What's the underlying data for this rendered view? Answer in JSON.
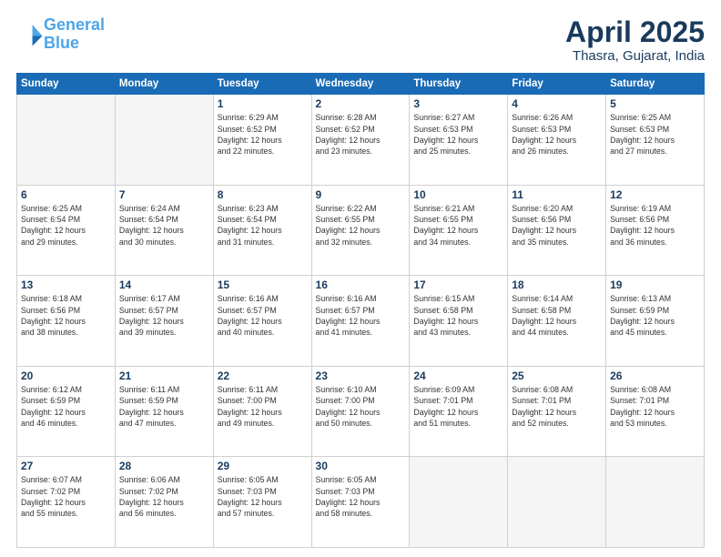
{
  "header": {
    "logo_line1": "General",
    "logo_line2": "Blue",
    "month_title": "April 2025",
    "location": "Thasra, Gujarat, India"
  },
  "weekdays": [
    "Sunday",
    "Monday",
    "Tuesday",
    "Wednesday",
    "Thursday",
    "Friday",
    "Saturday"
  ],
  "weeks": [
    [
      {
        "day": "",
        "empty": true
      },
      {
        "day": "",
        "empty": true
      },
      {
        "day": "1",
        "lines": [
          "Sunrise: 6:29 AM",
          "Sunset: 6:52 PM",
          "Daylight: 12 hours",
          "and 22 minutes."
        ]
      },
      {
        "day": "2",
        "lines": [
          "Sunrise: 6:28 AM",
          "Sunset: 6:52 PM",
          "Daylight: 12 hours",
          "and 23 minutes."
        ]
      },
      {
        "day": "3",
        "lines": [
          "Sunrise: 6:27 AM",
          "Sunset: 6:53 PM",
          "Daylight: 12 hours",
          "and 25 minutes."
        ]
      },
      {
        "day": "4",
        "lines": [
          "Sunrise: 6:26 AM",
          "Sunset: 6:53 PM",
          "Daylight: 12 hours",
          "and 26 minutes."
        ]
      },
      {
        "day": "5",
        "lines": [
          "Sunrise: 6:25 AM",
          "Sunset: 6:53 PM",
          "Daylight: 12 hours",
          "and 27 minutes."
        ]
      }
    ],
    [
      {
        "day": "6",
        "lines": [
          "Sunrise: 6:25 AM",
          "Sunset: 6:54 PM",
          "Daylight: 12 hours",
          "and 29 minutes."
        ]
      },
      {
        "day": "7",
        "lines": [
          "Sunrise: 6:24 AM",
          "Sunset: 6:54 PM",
          "Daylight: 12 hours",
          "and 30 minutes."
        ]
      },
      {
        "day": "8",
        "lines": [
          "Sunrise: 6:23 AM",
          "Sunset: 6:54 PM",
          "Daylight: 12 hours",
          "and 31 minutes."
        ]
      },
      {
        "day": "9",
        "lines": [
          "Sunrise: 6:22 AM",
          "Sunset: 6:55 PM",
          "Daylight: 12 hours",
          "and 32 minutes."
        ]
      },
      {
        "day": "10",
        "lines": [
          "Sunrise: 6:21 AM",
          "Sunset: 6:55 PM",
          "Daylight: 12 hours",
          "and 34 minutes."
        ]
      },
      {
        "day": "11",
        "lines": [
          "Sunrise: 6:20 AM",
          "Sunset: 6:56 PM",
          "Daylight: 12 hours",
          "and 35 minutes."
        ]
      },
      {
        "day": "12",
        "lines": [
          "Sunrise: 6:19 AM",
          "Sunset: 6:56 PM",
          "Daylight: 12 hours",
          "and 36 minutes."
        ]
      }
    ],
    [
      {
        "day": "13",
        "lines": [
          "Sunrise: 6:18 AM",
          "Sunset: 6:56 PM",
          "Daylight: 12 hours",
          "and 38 minutes."
        ]
      },
      {
        "day": "14",
        "lines": [
          "Sunrise: 6:17 AM",
          "Sunset: 6:57 PM",
          "Daylight: 12 hours",
          "and 39 minutes."
        ]
      },
      {
        "day": "15",
        "lines": [
          "Sunrise: 6:16 AM",
          "Sunset: 6:57 PM",
          "Daylight: 12 hours",
          "and 40 minutes."
        ]
      },
      {
        "day": "16",
        "lines": [
          "Sunrise: 6:16 AM",
          "Sunset: 6:57 PM",
          "Daylight: 12 hours",
          "and 41 minutes."
        ]
      },
      {
        "day": "17",
        "lines": [
          "Sunrise: 6:15 AM",
          "Sunset: 6:58 PM",
          "Daylight: 12 hours",
          "and 43 minutes."
        ]
      },
      {
        "day": "18",
        "lines": [
          "Sunrise: 6:14 AM",
          "Sunset: 6:58 PM",
          "Daylight: 12 hours",
          "and 44 minutes."
        ]
      },
      {
        "day": "19",
        "lines": [
          "Sunrise: 6:13 AM",
          "Sunset: 6:59 PM",
          "Daylight: 12 hours",
          "and 45 minutes."
        ]
      }
    ],
    [
      {
        "day": "20",
        "lines": [
          "Sunrise: 6:12 AM",
          "Sunset: 6:59 PM",
          "Daylight: 12 hours",
          "and 46 minutes."
        ]
      },
      {
        "day": "21",
        "lines": [
          "Sunrise: 6:11 AM",
          "Sunset: 6:59 PM",
          "Daylight: 12 hours",
          "and 47 minutes."
        ]
      },
      {
        "day": "22",
        "lines": [
          "Sunrise: 6:11 AM",
          "Sunset: 7:00 PM",
          "Daylight: 12 hours",
          "and 49 minutes."
        ]
      },
      {
        "day": "23",
        "lines": [
          "Sunrise: 6:10 AM",
          "Sunset: 7:00 PM",
          "Daylight: 12 hours",
          "and 50 minutes."
        ]
      },
      {
        "day": "24",
        "lines": [
          "Sunrise: 6:09 AM",
          "Sunset: 7:01 PM",
          "Daylight: 12 hours",
          "and 51 minutes."
        ]
      },
      {
        "day": "25",
        "lines": [
          "Sunrise: 6:08 AM",
          "Sunset: 7:01 PM",
          "Daylight: 12 hours",
          "and 52 minutes."
        ]
      },
      {
        "day": "26",
        "lines": [
          "Sunrise: 6:08 AM",
          "Sunset: 7:01 PM",
          "Daylight: 12 hours",
          "and 53 minutes."
        ]
      }
    ],
    [
      {
        "day": "27",
        "lines": [
          "Sunrise: 6:07 AM",
          "Sunset: 7:02 PM",
          "Daylight: 12 hours",
          "and 55 minutes."
        ]
      },
      {
        "day": "28",
        "lines": [
          "Sunrise: 6:06 AM",
          "Sunset: 7:02 PM",
          "Daylight: 12 hours",
          "and 56 minutes."
        ]
      },
      {
        "day": "29",
        "lines": [
          "Sunrise: 6:05 AM",
          "Sunset: 7:03 PM",
          "Daylight: 12 hours",
          "and 57 minutes."
        ]
      },
      {
        "day": "30",
        "lines": [
          "Sunrise: 6:05 AM",
          "Sunset: 7:03 PM",
          "Daylight: 12 hours",
          "and 58 minutes."
        ]
      },
      {
        "day": "",
        "empty": true
      },
      {
        "day": "",
        "empty": true
      },
      {
        "day": "",
        "empty": true
      }
    ]
  ]
}
